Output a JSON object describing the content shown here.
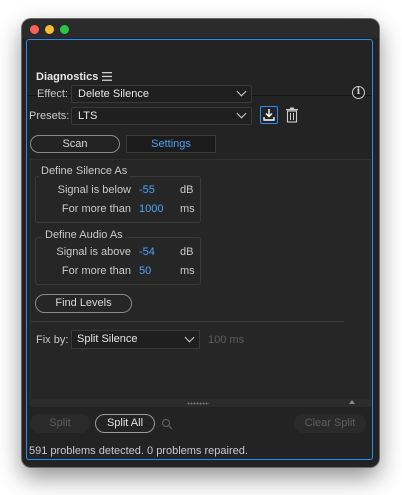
{
  "panel": {
    "title": "Diagnostics"
  },
  "effect": {
    "label": "Effect:",
    "value": "Delete Silence"
  },
  "presets": {
    "label": "Presets:",
    "value": "LTS"
  },
  "tabs": {
    "scan": "Scan",
    "settings": "Settings"
  },
  "silence_group": {
    "title": "Define Silence As",
    "rows": [
      {
        "label": "Signal is below",
        "value": "-55",
        "unit": "dB"
      },
      {
        "label": "For more than",
        "value": "1000",
        "unit": "ms"
      }
    ]
  },
  "audio_group": {
    "title": "Define Audio As",
    "rows": [
      {
        "label": "Signal is above",
        "value": "-54",
        "unit": "dB"
      },
      {
        "label": "For more than",
        "value": "50",
        "unit": "ms"
      }
    ]
  },
  "find_levels": "Find Levels",
  "fix_by": {
    "label": "Fix by:",
    "value": "Split Silence",
    "duration": "100 ms"
  },
  "buttons": {
    "split": "Split",
    "split_all": "Split All",
    "clear_split": "Clear Split"
  },
  "status": "591 problems detected. 0 problems repaired.",
  "icons": {
    "info": "info-icon",
    "save_preset": "download-icon",
    "delete_preset": "trash-icon",
    "menu": "hamburger-icon",
    "search": "search-icon"
  },
  "colors": {
    "accent": "#2d8ceb",
    "value": "#4da3f5",
    "panel_bg": "#232323"
  }
}
